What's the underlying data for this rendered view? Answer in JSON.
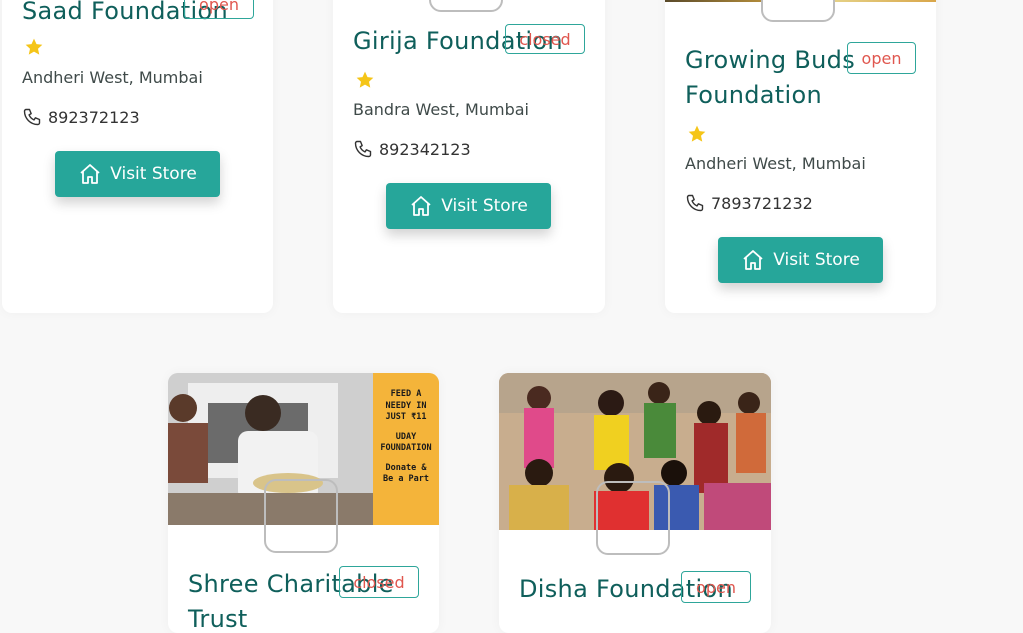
{
  "cards": [
    {
      "name_lines": [
        "Saad Foundation"
      ],
      "status": "open",
      "location": "Andheri West, Mumbai",
      "phone": "892372123",
      "button_label": "Visit Store"
    },
    {
      "name_lines": [
        "Girija Foundation"
      ],
      "status": "closed",
      "location": "Bandra West, Mumbai",
      "phone": "892342123",
      "button_label": "Visit Store"
    },
    {
      "name_lines": [
        "Growing Buds",
        "Foundation"
      ],
      "status": "open",
      "location": "Andheri West, Mumbai",
      "phone": "7893721232",
      "button_label": "Visit Store"
    },
    {
      "name_lines": [
        "Shree Charitable",
        "Trust"
      ],
      "status": "closed",
      "poster_text": [
        "FEED A",
        "NEEDY IN",
        "JUST ₹11",
        "UDAY",
        "FOUNDATION",
        "Donate &",
        "Be a Part"
      ]
    },
    {
      "name_lines": [
        "Disha Foundation"
      ],
      "status": "open"
    }
  ],
  "colors": {
    "accent": "#26a69a",
    "title": "#0f5f5b",
    "status_text": "#e0574f",
    "star": "#f5c518",
    "poster_bg": "#f4b43a"
  },
  "icons": [
    "star-icon",
    "phone-icon",
    "home-icon"
  ]
}
